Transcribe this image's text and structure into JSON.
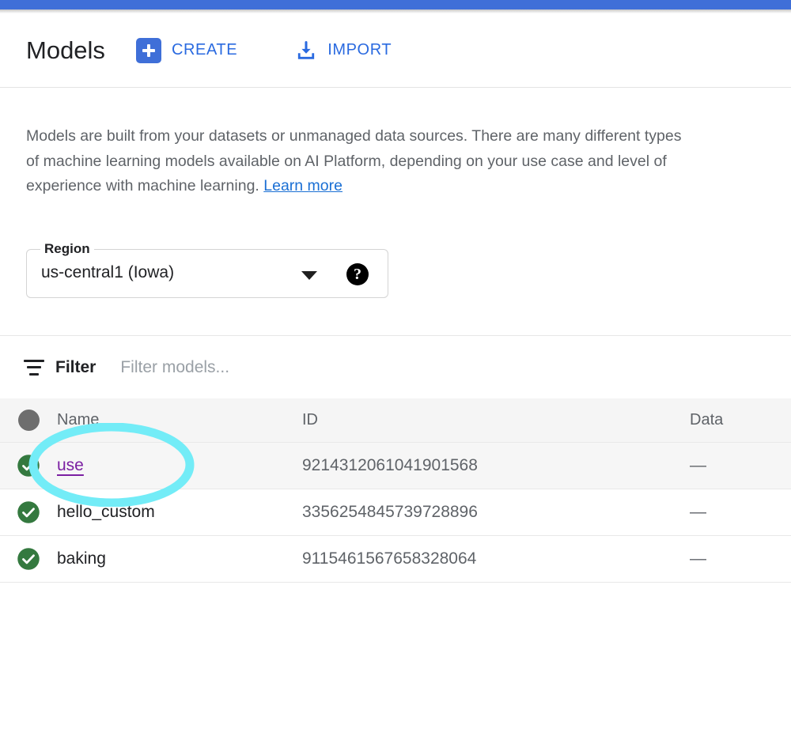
{
  "window": {
    "top_bar_color": "#3f6fd8"
  },
  "header": {
    "title": "Models",
    "actions": [
      {
        "id": "create",
        "label": "CREATE",
        "icon": "plus-square-icon",
        "color": "#2a6ae0"
      },
      {
        "id": "import",
        "label": "IMPORT",
        "icon": "download-icon",
        "color": "#2a6ae0"
      }
    ]
  },
  "description": {
    "text": "Models are built from your datasets or unmanaged data sources. There are many different types\nof machine learning models available on AI Platform, depending on your use case and level of\nexperience with machine learning. ",
    "link_label": "Learn more",
    "link_color": "#1a6fd4"
  },
  "region": {
    "legend": "Region",
    "value": "us-central1 (Iowa)",
    "dropdown_icon": "chevron-down-icon",
    "help_icon": "help-circle-icon",
    "help_glyph": "?",
    "options": [
      "us-central1 (Iowa)"
    ]
  },
  "filter": {
    "icon": "filter-icon",
    "label": "Filter",
    "placeholder": "Filter models...",
    "value": ""
  },
  "table": {
    "select_all_icon": "select-all-circle-icon",
    "columns": [
      "Name",
      "ID",
      "Data"
    ],
    "rows": [
      {
        "status_icon": "check-circle-icon",
        "status_color": "#34793f",
        "name": "use",
        "name_is_link": true,
        "id": "9214312061041901568",
        "data": "—",
        "selected": true
      },
      {
        "status_icon": "check-circle-icon",
        "status_color": "#34793f",
        "name": "hello_custom",
        "name_is_link": false,
        "id": "3356254845739728896",
        "data": "—",
        "selected": false
      },
      {
        "status_icon": "check-circle-icon",
        "status_color": "#34793f",
        "name": "baking",
        "name_is_link": false,
        "id": "9115461567658328064",
        "data": "—",
        "selected": false
      }
    ]
  },
  "annotation": {
    "shape": "ellipse",
    "color": "#73ecf7",
    "target": "use"
  }
}
